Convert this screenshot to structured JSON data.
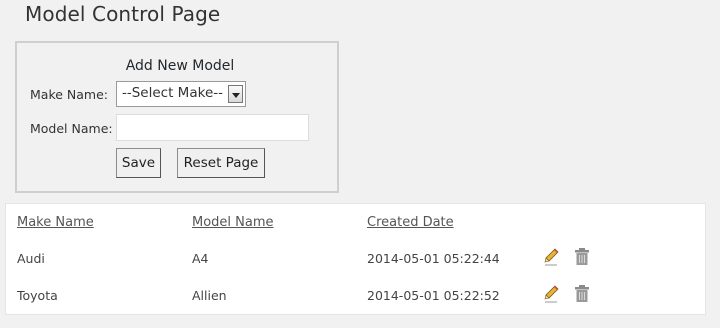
{
  "page": {
    "title": "Model Control Page"
  },
  "form": {
    "heading": "Add New Model",
    "make_label": "Make Name:",
    "make_selected": "--Select Make--",
    "model_label": "Model Name:",
    "model_value": "",
    "model_placeholder": "",
    "save_label": "Save",
    "reset_label": "Reset Page"
  },
  "table": {
    "headers": [
      "Make Name",
      "Model Name",
      "Created Date"
    ],
    "rows": [
      {
        "make": "Audi",
        "model": "A4",
        "created": "2014-05-01 05:22:44"
      },
      {
        "make": "Toyota",
        "model": "Allien",
        "created": "2014-05-01 05:22:52"
      }
    ],
    "icons": {
      "edit": "pencil-icon",
      "delete": "trash-icon"
    }
  },
  "colors": {
    "background": "#f1f1f1",
    "panel": "#ffffff",
    "form_border": "#cfcfcf",
    "pencil": "#d9a02a",
    "trash": "#8a8a8a"
  }
}
